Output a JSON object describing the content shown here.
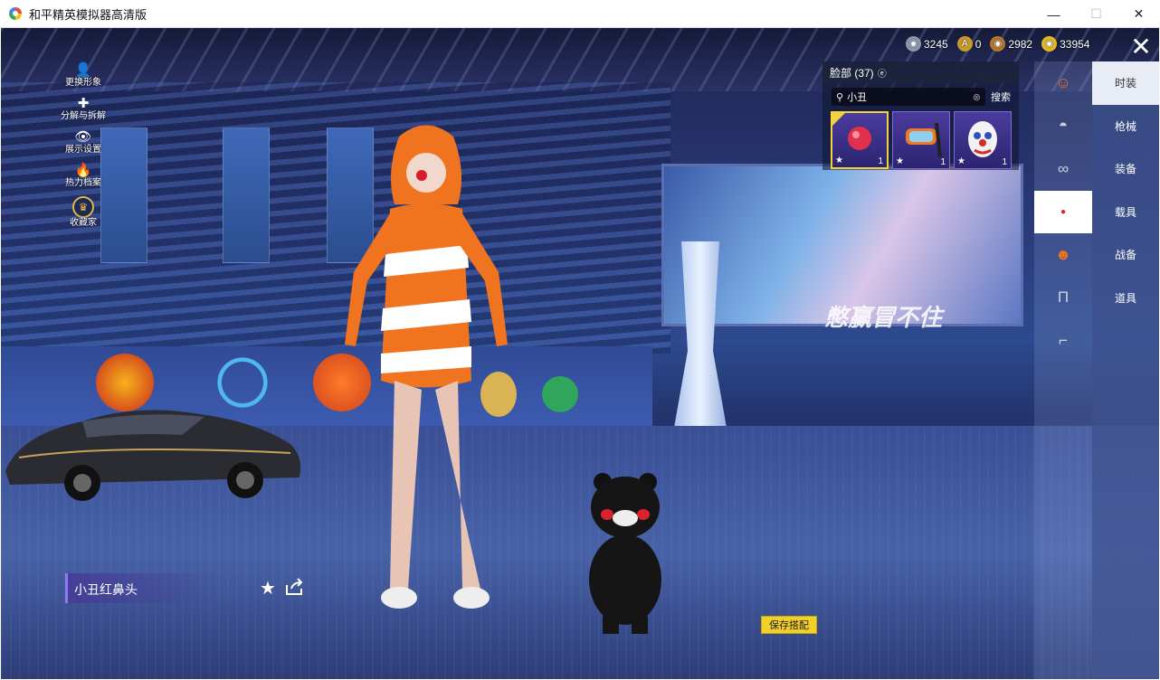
{
  "window": {
    "title": "和平精英模拟器高清版",
    "minimize": "—",
    "maximize": "☐",
    "close": "✕"
  },
  "left_menu": [
    {
      "label": "更换形象",
      "icon": "person-icon",
      "glyph": "👤"
    },
    {
      "label": "分解与拆解",
      "icon": "puzzle-icon",
      "glyph": "✚"
    },
    {
      "label": "展示设置",
      "icon": "eye-icon",
      "glyph": "👁"
    },
    {
      "label": "热力档案",
      "icon": "flame-icon",
      "glyph": "🔥"
    },
    {
      "label": "收藏家",
      "icon": "collector-badge-icon",
      "glyph": "♛"
    }
  ],
  "currencies": [
    {
      "value": "3245",
      "icon": "silver-coin-icon",
      "color": "#8c96b0"
    },
    {
      "value": "0",
      "icon": "gold-coin-icon",
      "color": "#c79a2b"
    },
    {
      "value": "2982",
      "icon": "bronze-coin-icon",
      "color": "#b7752c"
    },
    {
      "value": "33954",
      "icon": "coupon-icon",
      "color": "#e6b822"
    }
  ],
  "category": {
    "title": "脸部 (37)",
    "info_icon": "ⓔ",
    "search_value": "小丑",
    "search_button": "搜索",
    "clear_icon": "⊗",
    "items": [
      {
        "name": "clown-red-nose",
        "count": "1",
        "selected": true
      },
      {
        "name": "diving-mask",
        "count": "1",
        "selected": false
      },
      {
        "name": "clown-mask",
        "count": "1",
        "selected": false
      }
    ]
  },
  "rail_icons": [
    {
      "name": "character-head-icon",
      "glyph": "☺"
    },
    {
      "name": "cap-icon",
      "glyph": "◓"
    },
    {
      "name": "glasses-icon",
      "glyph": "∞"
    },
    {
      "name": "red-nose-icon",
      "glyph": "●"
    },
    {
      "name": "outfit-icon",
      "glyph": "☻"
    },
    {
      "name": "pants-icon",
      "glyph": "Π"
    },
    {
      "name": "shoes-icon",
      "glyph": "⌐"
    }
  ],
  "tabs": [
    "时装",
    "枪械",
    "装备",
    "载具",
    "战备",
    "道具"
  ],
  "active_tab": 0,
  "active_rail": 3,
  "selected_item_name": "小丑红鼻头",
  "favorite_icon": "★",
  "save_button": "保存搭配",
  "screen_text": "憋赢冒不住",
  "colors": {
    "accent_yellow": "#f2cf2a",
    "item_border": "#7c6ad8"
  }
}
